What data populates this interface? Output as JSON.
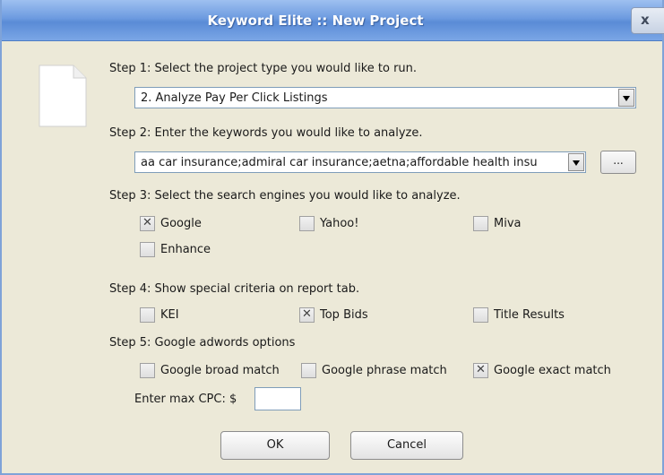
{
  "window": {
    "title": "Keyword Elite :: New Project",
    "close_label": "x"
  },
  "step1": {
    "label": "Step 1: Select the project type you would like to run.",
    "selected": "2. Analyze Pay Per Click Listings"
  },
  "step2": {
    "label": "Step 2: Enter the keywords you would like to analyze.",
    "value": "aa car insurance;admiral car insurance;aetna;affordable health insu",
    "browse_label": "..."
  },
  "step3": {
    "label": "Step 3: Select the search engines you would like to analyze.",
    "options": [
      {
        "label": "Google",
        "checked": true
      },
      {
        "label": "Yahoo!",
        "checked": false
      },
      {
        "label": "Miva",
        "checked": false
      },
      {
        "label": "Enhance",
        "checked": false
      }
    ]
  },
  "step4": {
    "label": "Step 4: Show special criteria on report tab.",
    "options": [
      {
        "label": "KEI",
        "checked": false
      },
      {
        "label": "Top Bids",
        "checked": true
      },
      {
        "label": "Title Results",
        "checked": false
      }
    ]
  },
  "step5": {
    "label": "Step 5: Google adwords options",
    "options": [
      {
        "label": "Google broad match",
        "checked": false
      },
      {
        "label": "Google phrase match",
        "checked": false
      },
      {
        "label": "Google exact match",
        "checked": true
      }
    ],
    "cpc_label": "Enter max CPC: $",
    "cpc_value": ""
  },
  "buttons": {
    "ok": "OK",
    "cancel": "Cancel"
  }
}
